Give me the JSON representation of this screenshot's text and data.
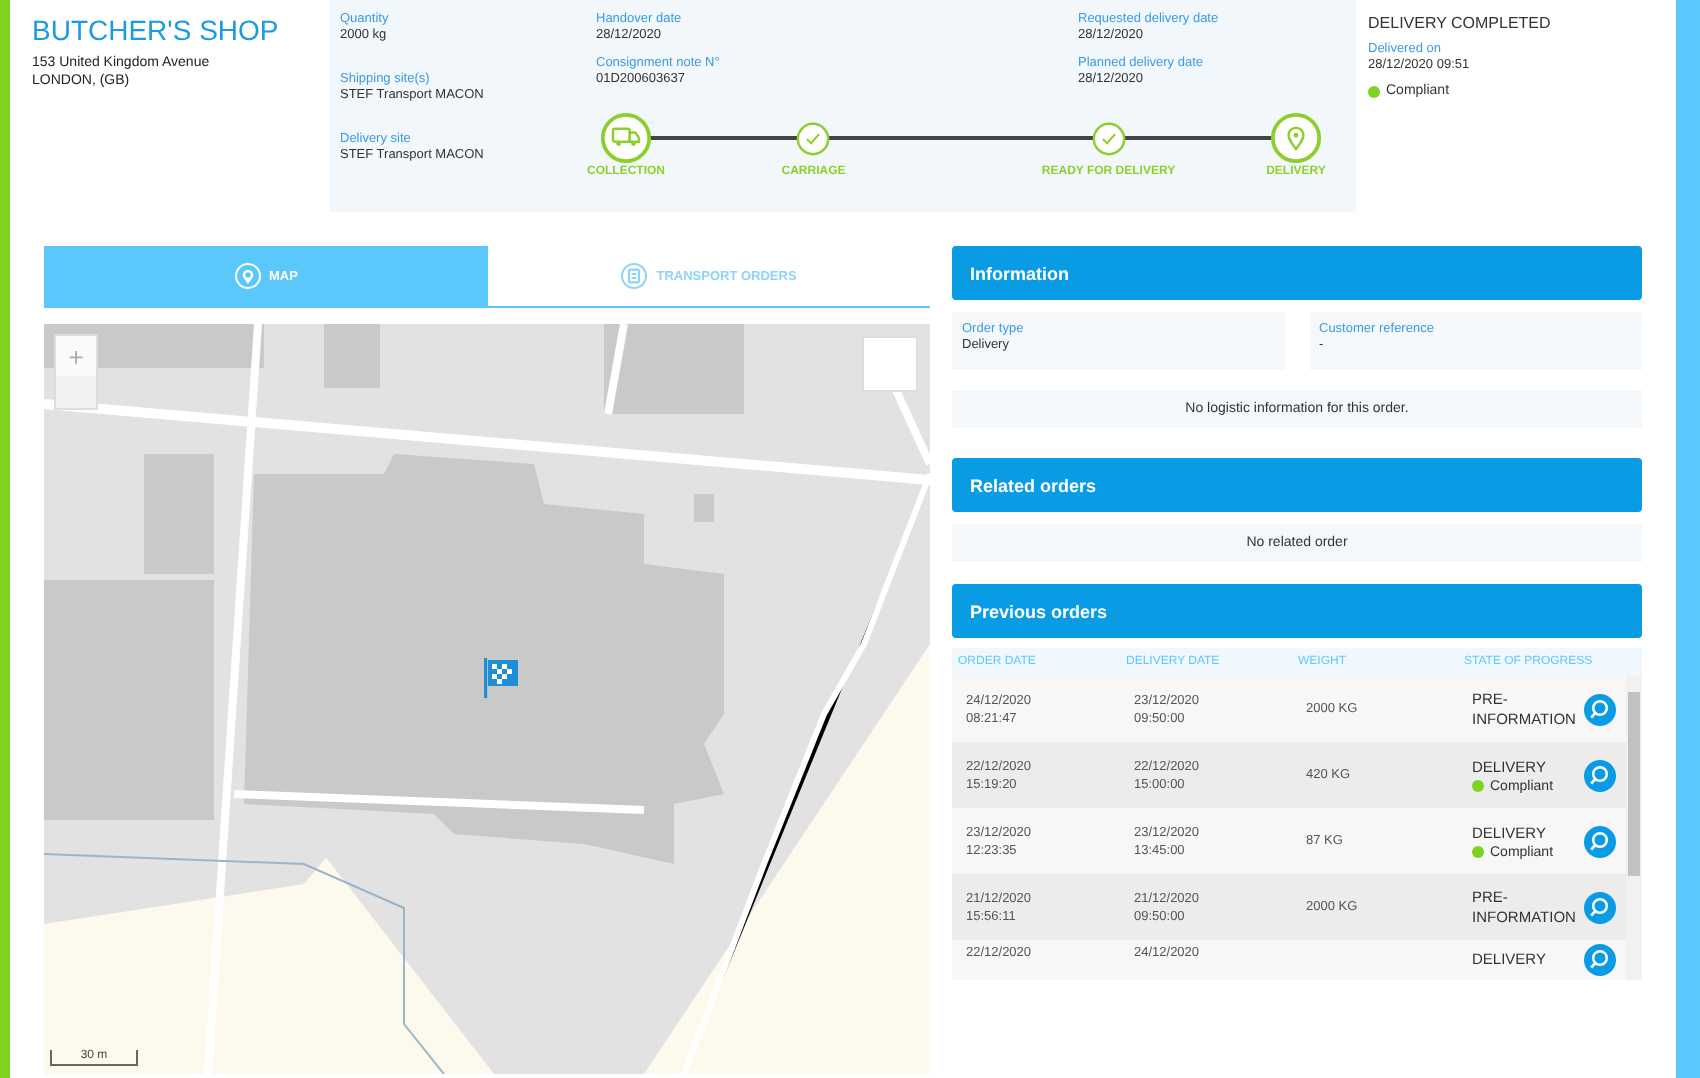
{
  "customer": {
    "name": "BUTCHER'S SHOP",
    "address_line_1": "153 United Kingdom Avenue",
    "address_line_2": "LONDON, (GB)"
  },
  "details": {
    "columns": [
      [
        {
          "label": "Quantity",
          "value": "2000 kg"
        },
        {
          "label": "Shipping site(s)",
          "value": "STEF Transport MACON"
        },
        {
          "label": "Delivery site",
          "value": "STEF Transport MACON"
        }
      ],
      [
        {
          "label": "Handover date",
          "value": "28/12/2020"
        },
        {
          "label": "Consignment note N°",
          "value": "01D200603637"
        }
      ],
      [
        {
          "label": "Requested delivery date",
          "value": "28/12/2020"
        },
        {
          "label": "Planned delivery date",
          "value": "28/12/2020"
        }
      ]
    ],
    "steps": [
      {
        "label": "COLLECTION",
        "kind": "truck",
        "done": true
      },
      {
        "label": "CARRIAGE",
        "kind": "check",
        "done": true
      },
      {
        "label": "READY FOR DELIVERY",
        "kind": "check",
        "done": true
      },
      {
        "label": "DELIVERY",
        "kind": "pin",
        "done": true
      }
    ]
  },
  "status": {
    "title": "DELIVERY COMPLETED",
    "label": "Delivered on",
    "value": "28/12/2020 09:51",
    "compliance": "Compliant",
    "compliant": true
  },
  "tabs": [
    {
      "label": "MAP",
      "selected": true
    },
    {
      "label": "TRANSPORT ORDERS",
      "selected": false
    }
  ],
  "map": {
    "zoom_in": "+",
    "scale": "30 m"
  },
  "information": {
    "title": "Information",
    "fields": [
      {
        "label": "Order type",
        "value": "Delivery"
      },
      {
        "label": "Customer reference",
        "value": "-"
      }
    ],
    "note": "No logistic information for this order."
  },
  "related_orders": {
    "title": "Related orders",
    "note": "No related order"
  },
  "previous_orders": {
    "title": "Previous orders",
    "columns": [
      "ORDER DATE",
      "DELIVERY DATE",
      "WEIGHT",
      "STATE OF PROGRESS"
    ],
    "rows": [
      {
        "order_date": "24/12/2020",
        "order_time": "08:21:47",
        "delivery_date": "23/12/2020",
        "delivery_time": "09:50:00",
        "weight": "2000 KG",
        "state": "PRE-INFORMATION",
        "compliant": false
      },
      {
        "order_date": "22/12/2020",
        "order_time": "15:19:20",
        "delivery_date": "22/12/2020",
        "delivery_time": "15:00:00",
        "weight": "420 KG",
        "state": "DELIVERY",
        "compliant": true,
        "compliance": "Compliant"
      },
      {
        "order_date": "23/12/2020",
        "order_time": "12:23:35",
        "delivery_date": "23/12/2020",
        "delivery_time": "13:45:00",
        "weight": "87 KG",
        "state": "DELIVERY",
        "compliant": true,
        "compliance": "Compliant"
      },
      {
        "order_date": "21/12/2020",
        "order_time": "15:56:11",
        "delivery_date": "21/12/2020",
        "delivery_time": "09:50:00",
        "weight": "2000 KG",
        "state": "PRE-INFORMATION",
        "compliant": false
      },
      {
        "order_date": "22/12/2020",
        "delivery_date": "24/12/2020",
        "state": "DELIVERY",
        "compliant": false
      }
    ]
  }
}
